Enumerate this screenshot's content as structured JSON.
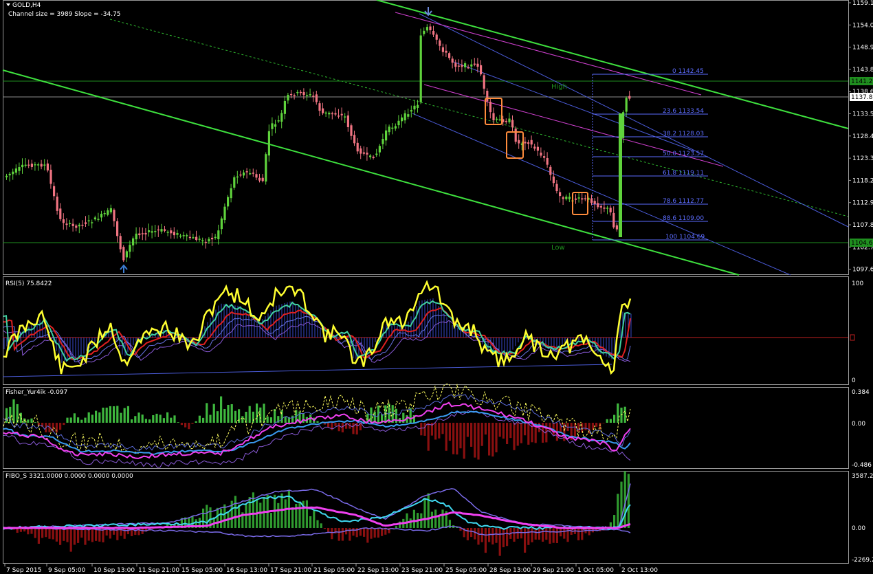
{
  "window": {
    "symbol_title": "GOLD,H4",
    "channel_info": "Channel size = 3989 Slope = -34.75"
  },
  "colors": {
    "background": "#000000",
    "bull": "#5fd23c",
    "bear": "#f07482",
    "channel": "#3ee03e",
    "magenta": "#d040d0",
    "blue_channel": "#4a5bd8",
    "fib": "#5d6dff",
    "rsi": "#ffff30",
    "grid": "#1c6e1c"
  },
  "price_axis": {
    "labels": [
      "1159.15",
      "1154.05",
      "1148.90",
      "1143.80",
      "1138.60",
      "1133.50",
      "1128.40",
      "1123.30",
      "1118.20",
      "1112.95",
      "1107.85",
      "1102.75",
      "1097.65"
    ],
    "highlight_top": "1141.25",
    "current": "1137.80",
    "highlight_low": "1104.6"
  },
  "levels": {
    "high": "High",
    "low": "Low"
  },
  "fib_levels": [
    "0 1142.45",
    "23.6 1133.54",
    "38.2 1128.03",
    "50.0 1123.57",
    "61.8 1119.11",
    "78.6 1112.77",
    "88.6 1109.00",
    "100 1104.69"
  ],
  "time_axis": [
    "7 Sep 2015",
    "9 Sep 05:00",
    "10 Sep 13:00",
    "11 Sep 21:00",
    "15 Sep 05:00",
    "16 Sep 13:00",
    "17 Sep 21:00",
    "21 Sep 05:00",
    "22 Sep 13:00",
    "23 Sep 21:00",
    "25 Sep 05:00",
    "28 Sep 13:00",
    "29 Sep 21:00",
    "1 Oct 05:00",
    "2 Oct 13:00"
  ],
  "rsi": {
    "title": "RSI(5) 75.8422",
    "axis_top": "100",
    "axis_bottom": "0"
  },
  "fisher": {
    "title": "Fisher_Yur4ik -0.097",
    "axis_top": "0.384",
    "axis_mid": "0.00",
    "axis_bottom": "-0.486"
  },
  "fibo_s": {
    "title": "FIBO_S 3321.0000 0.0000 0.0000 0.0000",
    "axis_top": "3587.2",
    "axis_mid": "0.00",
    "axis_bottom": "-2269.2"
  }
}
